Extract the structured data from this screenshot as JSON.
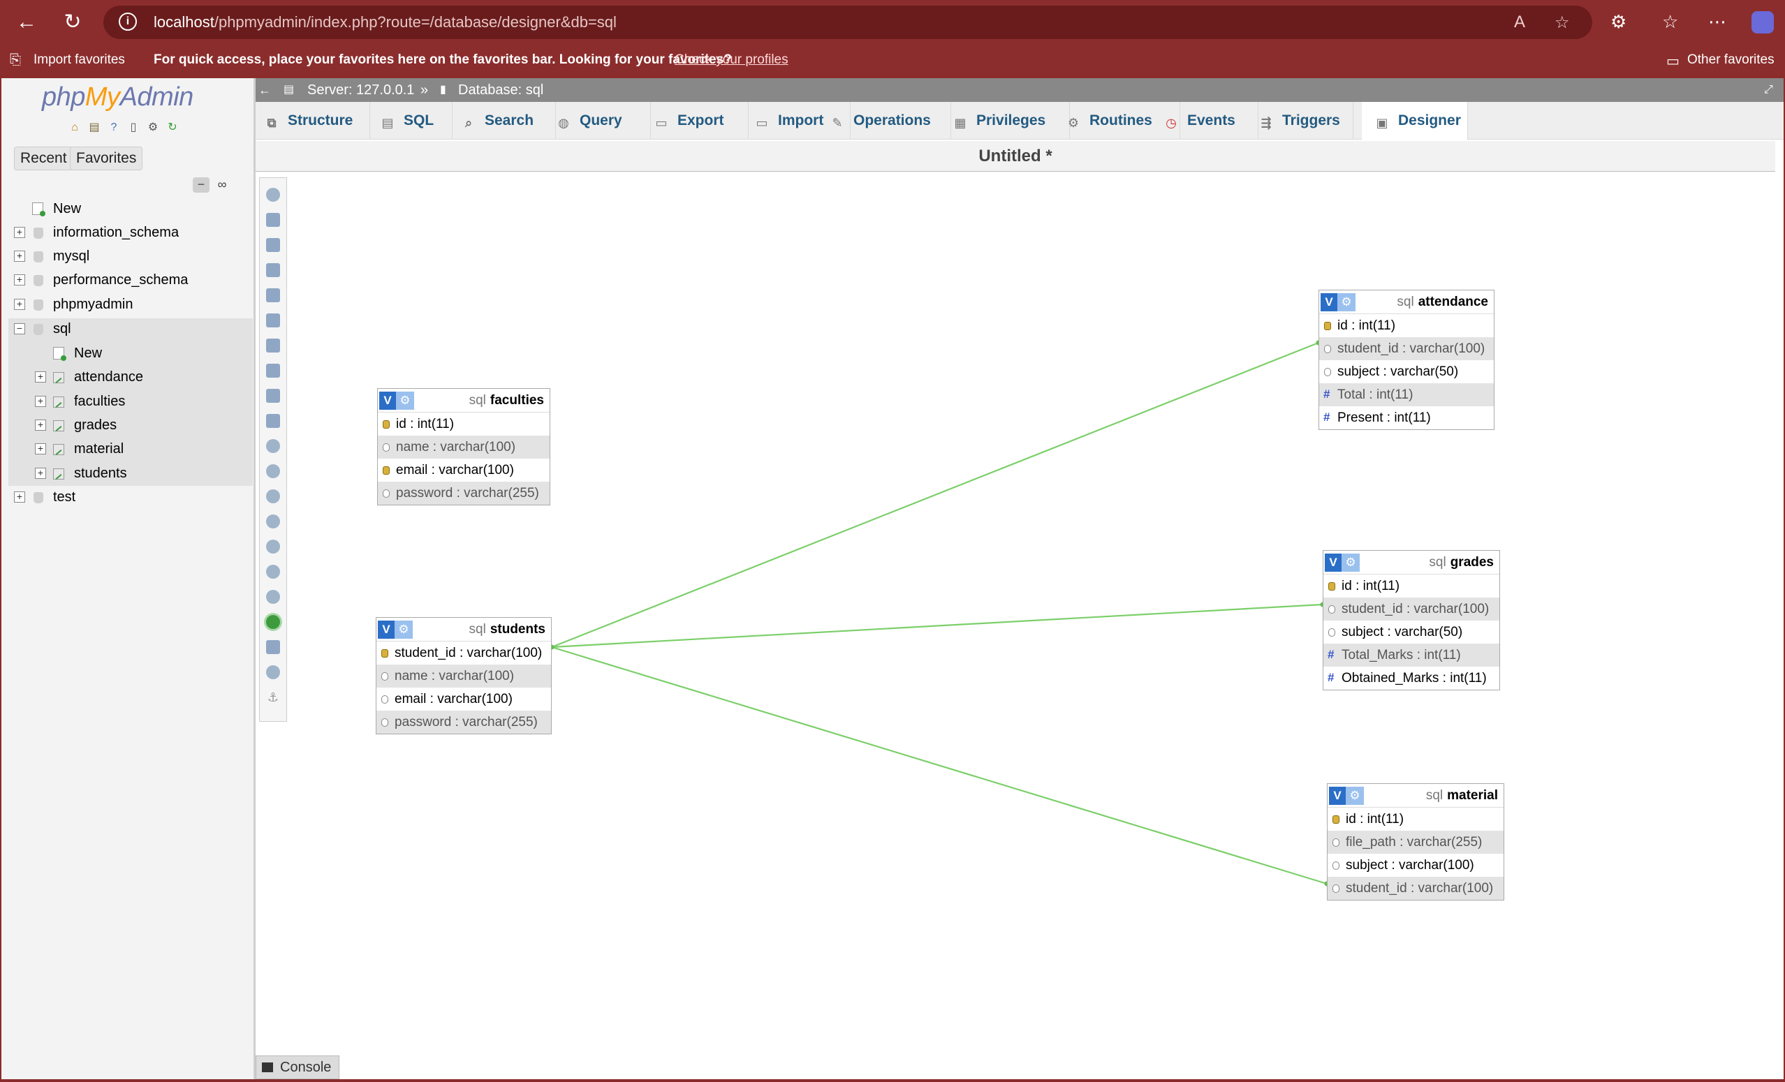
{
  "browser": {
    "url_host": "localhost",
    "url_path": "/phpmyadmin/index.php?route=/database/designer&db=sql",
    "favorites_bar": {
      "import_label": "Import favorites",
      "message": "For quick access, place your favorites here on the favorites bar. Looking for your favorites?",
      "link": "Check your profiles",
      "other_label": "Other favorites"
    }
  },
  "logo": {
    "php": "php",
    "my": "My",
    "admin": "Admin"
  },
  "nav": {
    "recent_label": "Recent",
    "favorites_label": "Favorites",
    "tree": {
      "new": "New",
      "databases": [
        "information_schema",
        "mysql",
        "performance_schema",
        "phpmyadmin",
        "sql",
        "test"
      ],
      "sql_children": {
        "new": "New",
        "tables": [
          "attendance",
          "faculties",
          "grades",
          "material",
          "students"
        ]
      }
    }
  },
  "breadcrumb": {
    "server": "Server: 127.0.0.1",
    "separator": "»",
    "database": "Database: sql"
  },
  "tabs": [
    "Structure",
    "SQL",
    "Search",
    "Query",
    "Export",
    "Import",
    "Operations",
    "Privileges",
    "Routines",
    "Events",
    "Triggers",
    "Designer"
  ],
  "designer": {
    "title": "Untitled *",
    "tables": {
      "faculties": {
        "db": "sql",
        "name": "faculties",
        "columns": [
          "id : int(11)",
          "name : varchar(100)",
          "email : varchar(100)",
          "password : varchar(255)"
        ]
      },
      "students": {
        "db": "sql",
        "name": "students",
        "columns": [
          "student_id : varchar(100)",
          "name : varchar(100)",
          "email : varchar(100)",
          "password : varchar(255)"
        ]
      },
      "attendance": {
        "db": "sql",
        "name": "attendance",
        "columns": [
          "id : int(11)",
          "student_id : varchar(100)",
          "subject : varchar(50)",
          "Total : int(11)",
          "Present : int(11)"
        ]
      },
      "grades": {
        "db": "sql",
        "name": "grades",
        "columns": [
          "id : int(11)",
          "student_id : varchar(100)",
          "subject : varchar(50)",
          "Total_Marks : int(11)",
          "Obtained_Marks : int(11)"
        ]
      },
      "material": {
        "db": "sql",
        "name": "material",
        "columns": [
          "id : int(11)",
          "file_path : varchar(255)",
          "subject : varchar(100)",
          "student_id : varchar(100)"
        ]
      }
    },
    "relation_color": "#7ccf6a"
  },
  "console_label": "Console"
}
